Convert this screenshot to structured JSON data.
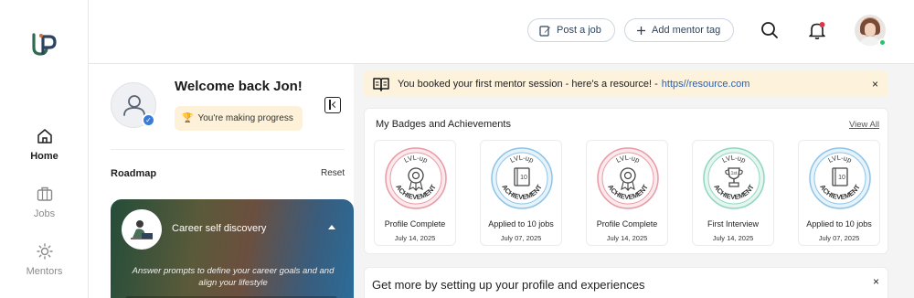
{
  "sidebar": {
    "logo_name": "lvl-up-logo",
    "items": [
      {
        "label": "Home",
        "icon": "home-icon"
      },
      {
        "label": "Jobs",
        "icon": "briefcase-icon"
      },
      {
        "label": "Mentors",
        "icon": "sun-icon"
      }
    ]
  },
  "header": {
    "post_job_label": "Post a job",
    "add_mentor_tag_label": "Add mentor tag"
  },
  "profile": {
    "welcome": "Welcome back Jon!",
    "progress_badge": "You're making progress"
  },
  "roadmap": {
    "title": "Roadmap",
    "reset_label": "Reset",
    "card": {
      "title": "Career self discovery",
      "description": "Answer prompts to define your career goals and and align your lifestyle"
    }
  },
  "banner": {
    "text": "You booked your first mentor session - here's a resource! -",
    "link": "https//resource.com",
    "close": "×"
  },
  "badges": {
    "title": "My Badges and Achievements",
    "view_all": "View All",
    "arc_top": "LVL-up",
    "arc_bottom": "ACHIEVEMENT",
    "items": [
      {
        "name": "Profile Complete",
        "date": "July 14, 2025",
        "icon": "rosette-icon",
        "color": "#e89aa6",
        "fill": "#fbe9ec"
      },
      {
        "name": "Applied to 10 jobs",
        "date": "July 07, 2025",
        "icon": "book-icon",
        "color": "#8cc4e8",
        "fill": "#e6f3fb",
        "number": "10"
      },
      {
        "name": "Profile Complete",
        "date": "July 14, 2025",
        "icon": "rosette-icon",
        "color": "#e89aa6",
        "fill": "#fbe9ec"
      },
      {
        "name": "First Interview",
        "date": "July 14, 2025",
        "icon": "trophy-icon",
        "color": "#8fd6c0",
        "fill": "#e5f6f0",
        "number": "1st"
      },
      {
        "name": "Applied to 10 jobs",
        "date": "July 07, 2025",
        "icon": "book-icon",
        "color": "#8cc4e8",
        "fill": "#e6f3fb",
        "number": "10"
      }
    ]
  },
  "setup": {
    "title": "Get more by setting up your profile and experiences",
    "close": "×"
  },
  "colors": {
    "accent_blue": "#2e5fa8",
    "banner_bg": "#fdf2dc",
    "online": "#27c46b",
    "notification": "#e0334a"
  }
}
